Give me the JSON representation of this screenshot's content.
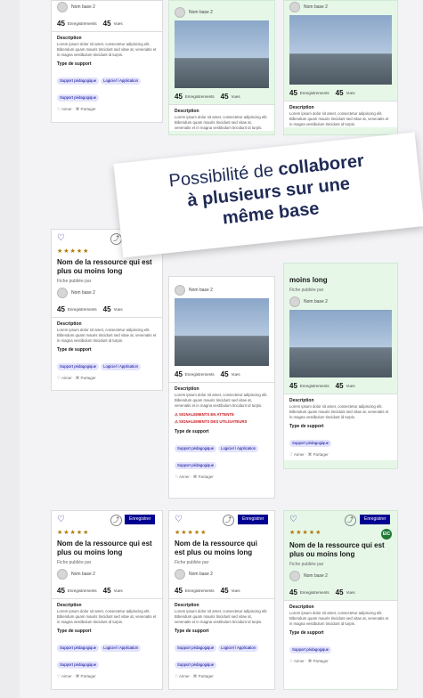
{
  "banner": {
    "l1_prefix": "Possibilité de ",
    "l1_bold": "collaborer",
    "l2": "à plusieurs sur une",
    "l3": "même base"
  },
  "card": {
    "title": "Nom de la ressource qui est plus ou moins long",
    "title_cut": "Nom de la ressource qui est plus ou moins long",
    "title_short": "moins long",
    "meta": "Fiche publiée par",
    "meta_alt": "Fiche publiée par",
    "author": "Nom base 2",
    "author_alt": "Nom base 2",
    "stats_count": "45",
    "stats_enr": "Enregistrements",
    "stats_vues": "Vues",
    "desc_title": "Description",
    "desc_text": "Lorem ipsum dolor sit amet, consectetur adipiscing elit. Bibendum quam mauris tincidunt sed vitae at, venenatis et in magna vestibulum tincidunt id turpis.",
    "support_title": "Type de support",
    "chip1": "Support pédagogique",
    "chip2": "Logiciel / Application",
    "actions": "♡ Aimer · ⌘ Partager",
    "save": "Enregistrer",
    "logo": "EIC",
    "warn1": "⚠ SIGNALEMENTS EN ATTENTE",
    "warn2": "⚠ SIGNALEMENTS DES UTILISATEURS",
    "partial_top": "Nom base 2"
  }
}
